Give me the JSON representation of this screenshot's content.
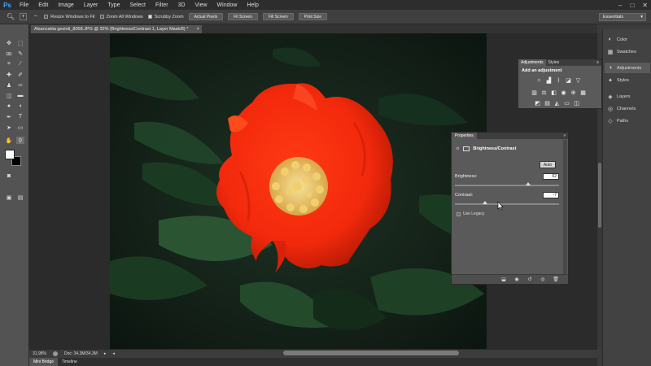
{
  "menu": {
    "logo": "Ps",
    "items": [
      "File",
      "Edit",
      "Image",
      "Layer",
      "Type",
      "Select",
      "Filter",
      "3D",
      "View",
      "Window",
      "Help"
    ]
  },
  "options": {
    "resize_windows": "Resize Windows to Fit",
    "zoom_all": "Zoom All Windows",
    "scrubby_zoom": "Scrubby Zoom",
    "actual_pixels": "Actual Pixels",
    "fit_screen": "Fit Screen",
    "fill_screen": "Fill Screen",
    "print_size": "Print Size",
    "workspace": "Essentials"
  },
  "document": {
    "tab_title": "Alsancakta gezinti_8058.JPG @ 32% (Brightness/Contrast 1, Layer Mask/8) *",
    "zoom": "31,98%",
    "doc_info": "Doc: 34,3M/34,3M"
  },
  "bottom_tabs": [
    "Mini Bridge",
    "Timeline"
  ],
  "dock": {
    "items": [
      {
        "label": "Color",
        "icon": "color-icon"
      },
      {
        "label": "Swatches",
        "icon": "swatches-icon"
      },
      {
        "label": "Adjustments",
        "icon": "adjustments-icon"
      },
      {
        "label": "Styles",
        "icon": "styles-icon"
      },
      {
        "label": "Layers",
        "icon": "layers-icon"
      },
      {
        "label": "Channels",
        "icon": "channels-icon"
      },
      {
        "label": "Paths",
        "icon": "paths-icon"
      }
    ]
  },
  "adjustments": {
    "tab_active": "Adjustments",
    "tab_other": "Styles",
    "subtitle": "Add an adjustment"
  },
  "properties": {
    "tab": "Properties",
    "title": "Brightness/Contrast",
    "auto": "Auto",
    "brightness_label": "Brightness:",
    "brightness_value": "62",
    "contrast_label": "Contrast:",
    "contrast_value": "-7",
    "legacy_label": "Use Legacy"
  }
}
